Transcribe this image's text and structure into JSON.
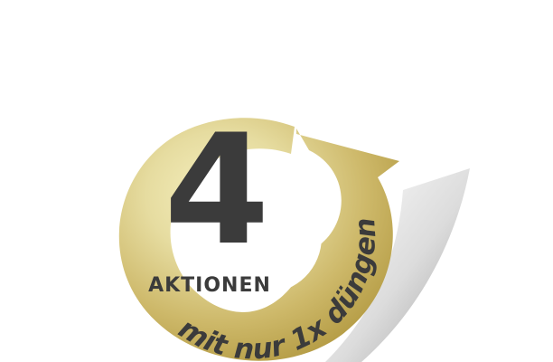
{
  "badge": {
    "number": "4",
    "caption": "AKTIONEN",
    "slogan": "mit nur 1x düngen"
  },
  "colors": {
    "background": "#ffffff",
    "gold_light": "#f3ecb3",
    "gold_mid": "#dccd7d",
    "gold_dark": "#b59a3c",
    "text": "#3b3b3b"
  },
  "icons": [
    "circular-arrow-icon"
  ]
}
